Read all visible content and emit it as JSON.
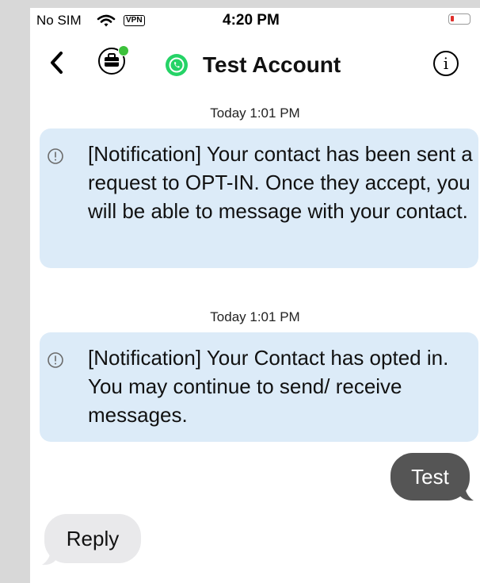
{
  "status_bar": {
    "carrier": "No SIM",
    "vpn": "VPN",
    "time": "4:20 PM",
    "battery_color": "#e0302c"
  },
  "header": {
    "title": "Test Account",
    "info_glyph": "i",
    "icons": [
      "chevron-left-icon",
      "briefcase-icon",
      "whatsapp-icon",
      "info-icon"
    ],
    "online_color": "#3cc13b"
  },
  "messages": [
    {
      "type": "system",
      "timestamp": "Today 1:01 PM",
      "text": "[Notification] Your contact has been sent a request to OPT-IN. Once they accept, you will be able to message with your contact."
    },
    {
      "type": "system",
      "timestamp": "Today 1:01 PM",
      "text": "[Notification] Your Contact has opted in. You may continue to send/ receive messages."
    },
    {
      "type": "outgoing",
      "text": "Test"
    },
    {
      "type": "incoming",
      "text": "Reply"
    }
  ],
  "colors": {
    "notice_bg": "#dcebf8",
    "outgoing_bg": "#555555",
    "incoming_bg": "#e9e9eb"
  }
}
